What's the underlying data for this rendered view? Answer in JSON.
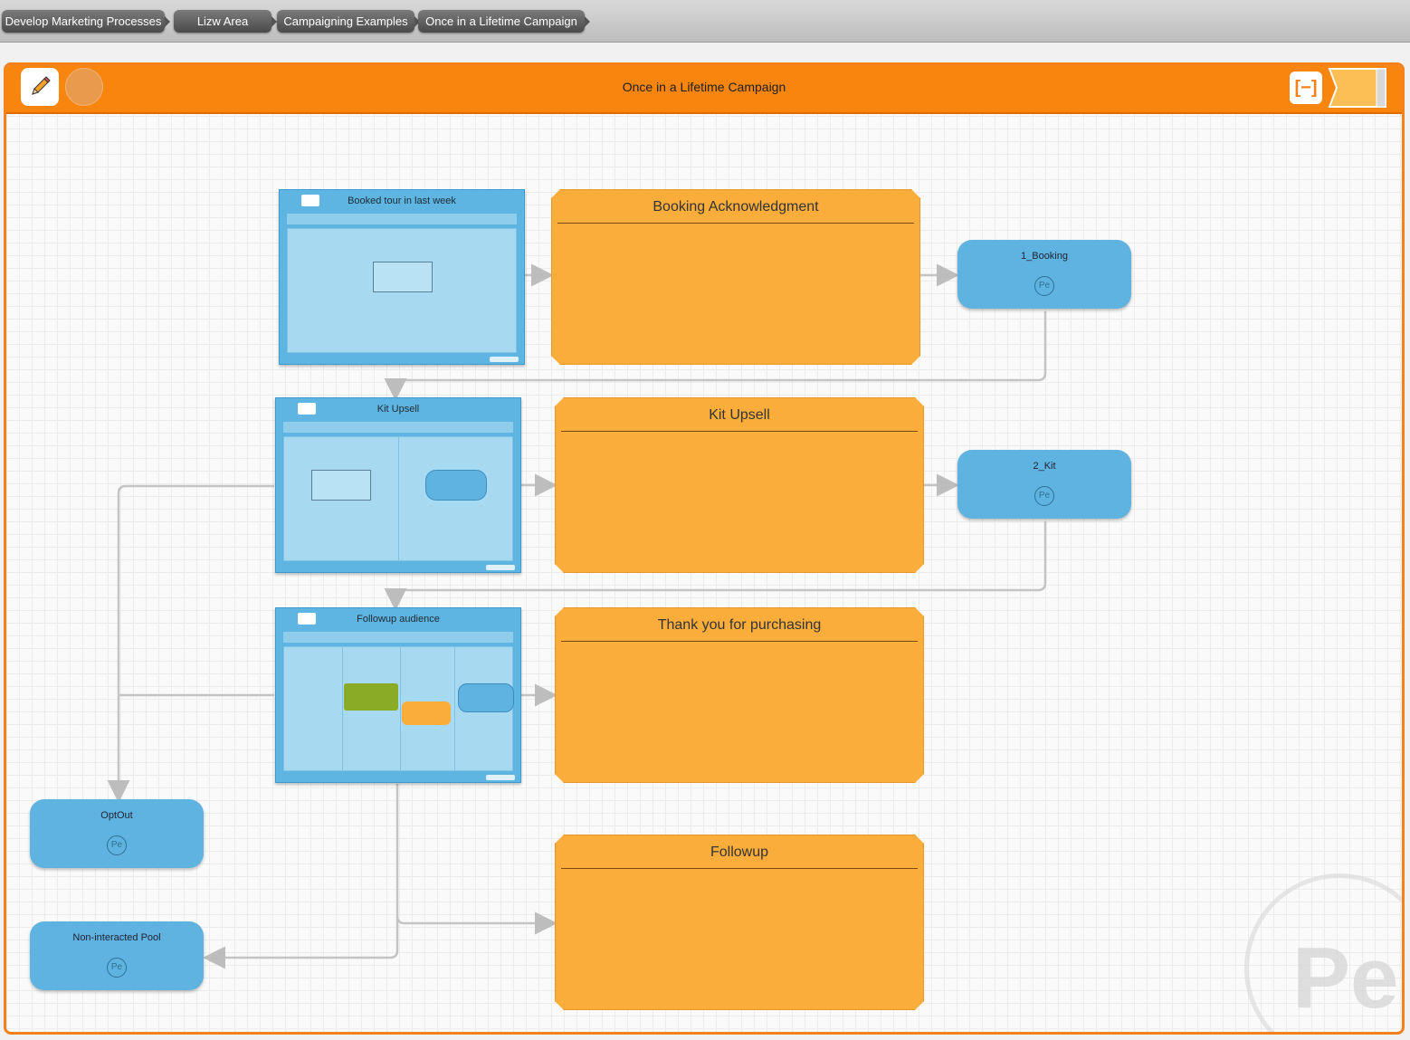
{
  "breadcrumbs": [
    "Develop Marketing Processes",
    "Lizw Area",
    "Campaigning Examples",
    "Once in a Lifetime Campaign"
  ],
  "header": {
    "title": "Once in a Lifetime Campaign"
  },
  "panels": [
    {
      "title": "Booked tour in last week"
    },
    {
      "title": "Kit Upsell"
    },
    {
      "title": "Followup audience"
    }
  ],
  "messages": [
    {
      "title": "Booking Acknowledgment"
    },
    {
      "title": "Kit Upsell"
    },
    {
      "title": "Thank you for purchasing"
    },
    {
      "title": "Followup"
    }
  ],
  "pools": [
    {
      "title": "1_Booking",
      "badge": "Pe"
    },
    {
      "title": "2_Kit",
      "badge": "Pe"
    },
    {
      "title": "OptOut",
      "badge": "Pe"
    },
    {
      "title": "Non-interacted Pool",
      "badge": "Pe"
    }
  ],
  "watermark": "Pe",
  "colors": {
    "accent": "#f8860e",
    "message": "#fbad3c",
    "pool": "#5fb3e0",
    "connector": "#bdbdbd"
  }
}
